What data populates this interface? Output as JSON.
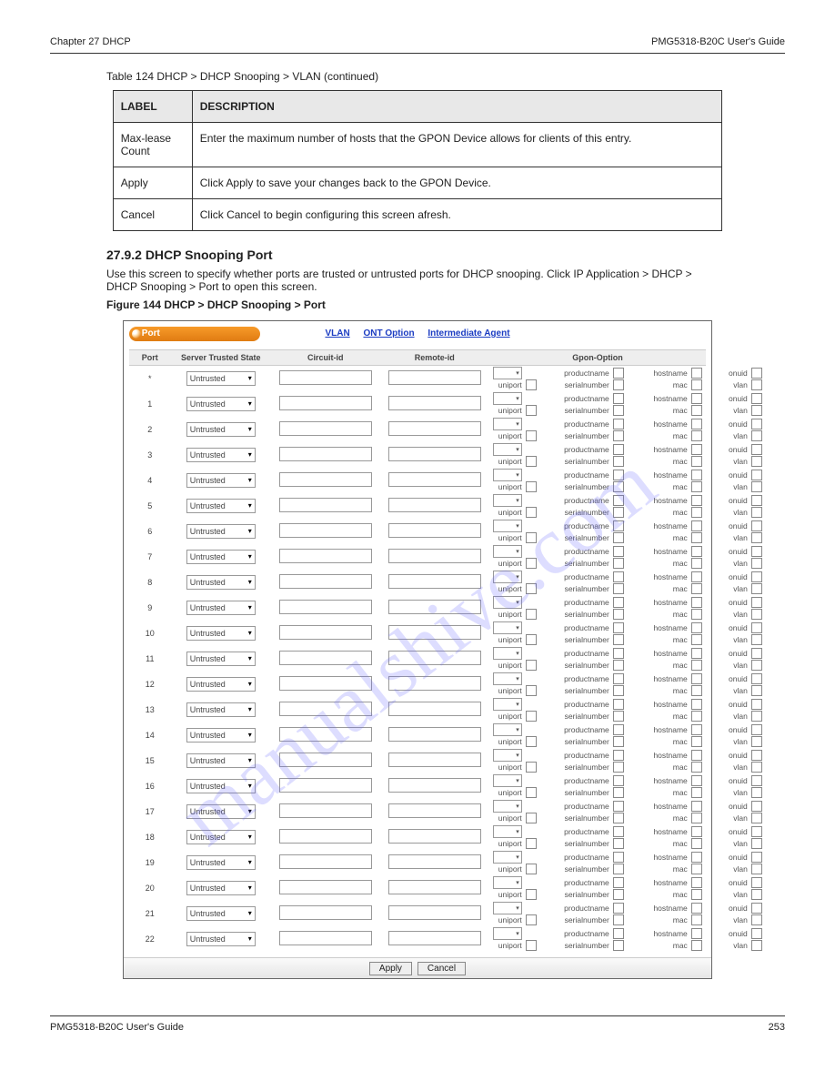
{
  "header": {
    "left": "Chapter 27 DHCP",
    "right": "PMG5318-B20C User's Guide"
  },
  "topTable": {
    "columns": [
      "LABEL",
      "DESCRIPTION"
    ],
    "rows": [
      [
        "LABEL",
        "DESCRIPTION"
      ],
      [
        "Max-lease Count",
        "Enter the maximum number of hosts that the GPON Device allows for clients of this entry."
      ],
      [
        "Apply",
        "Click Apply to save your changes back to the GPON Device."
      ],
      [
        "Cancel",
        "Click Cancel to begin configuring this screen afresh."
      ]
    ],
    "table_header_pairs": [
      [
        "Apply",
        "Click Apply to save your changes back to the GPON Device."
      ],
      [
        "Cancel",
        "Click Cancel to begin configuring this screen afresh."
      ]
    ]
  },
  "table124_caption": "Table 124   DHCP > DHCP Snooping > VLAN (continued)",
  "section_number": "27.9.2  DHCP Snooping Port",
  "section_text": "Use this screen to specify whether ports are trusted or untrusted ports for DHCP snooping. Click IP Application > DHCP > DHCP Snooping > Port to open this screen.",
  "figure_caption": "Figure 144   DHCP > DHCP Snooping > Port",
  "orange_label": "Port",
  "topnav": {
    "vlan": "VLAN",
    "ont": "ONT Option",
    "ia": "Intermediate Agent"
  },
  "grid": {
    "columns": [
      "Port",
      "Server Trusted State",
      "Circuit-id",
      "Remote-id",
      "Gpon-Option"
    ],
    "trusted_value": "Untrusted",
    "ports": [
      "*",
      "1",
      "2",
      "3",
      "4",
      "5",
      "6",
      "7",
      "8",
      "9",
      "10",
      "11",
      "12",
      "13",
      "14",
      "15",
      "16",
      "17",
      "18",
      "19",
      "20",
      "21",
      "22"
    ],
    "gopt": {
      "row1": [
        "",
        "",
        "productname",
        "",
        "hostname",
        "",
        "onuid",
        ""
      ],
      "row2": [
        "uniport",
        "",
        "serialnumber",
        "",
        "mac",
        "",
        "vlan",
        ""
      ]
    }
  },
  "buttons": {
    "apply": "Apply",
    "cancel": "Cancel"
  },
  "footer": {
    "left": "PMG5318-B20C User's Guide",
    "right": "253"
  },
  "watermark": "manualshive.com"
}
